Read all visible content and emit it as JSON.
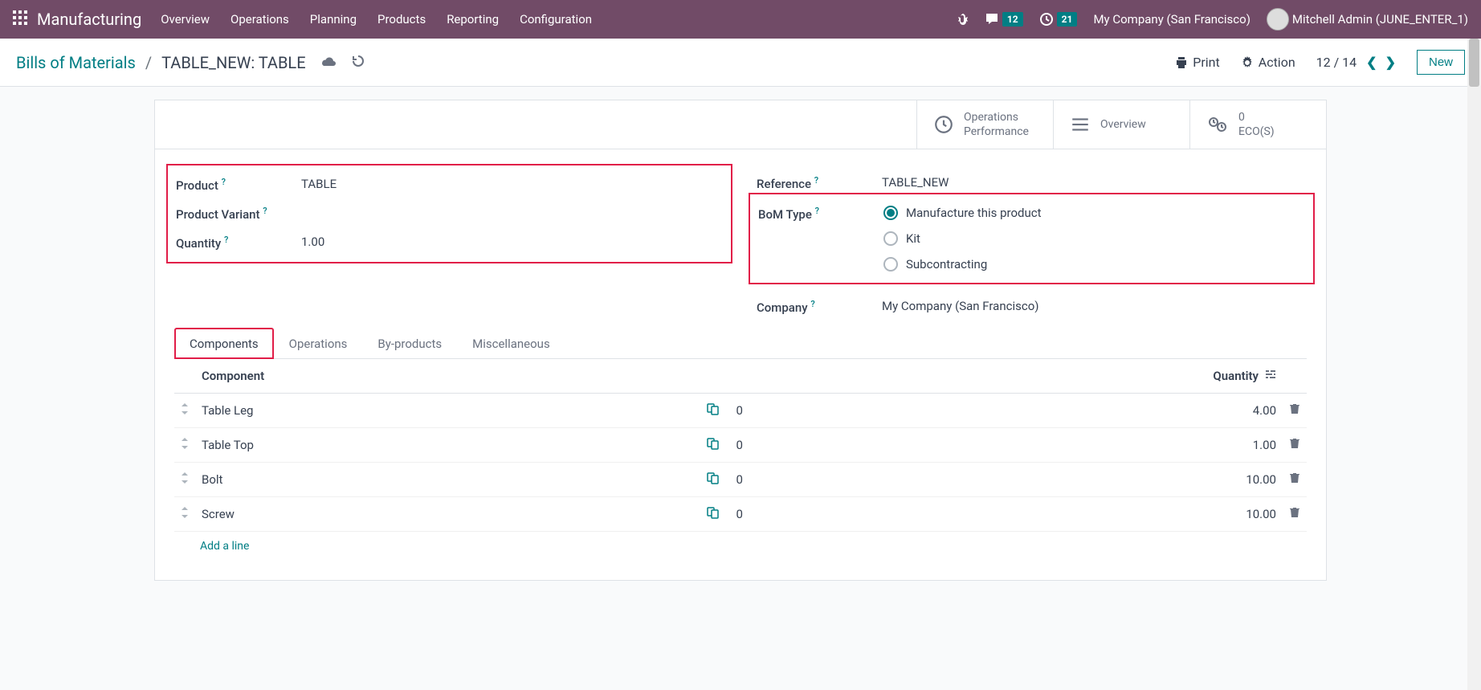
{
  "nav": {
    "brand": "Manufacturing",
    "items": [
      "Overview",
      "Operations",
      "Planning",
      "Products",
      "Reporting",
      "Configuration"
    ],
    "chat_count": "12",
    "activity_count": "21",
    "company": "My Company (San Francisco)",
    "user": "Mitchell Admin (JUNE_ENTER_1)"
  },
  "breadcrumb": {
    "root": "Bills of Materials",
    "current": "TABLE_NEW: TABLE"
  },
  "control": {
    "print": "Print",
    "action": "Action",
    "pager": "12 / 14",
    "new": "New"
  },
  "stat": {
    "ops1": "Operations",
    "ops2": "Performance",
    "overview": "Overview",
    "eco_count": "0",
    "eco_label": "ECO(S)"
  },
  "form": {
    "left": {
      "product_label": "Product",
      "product_value": "TABLE",
      "variant_label": "Product Variant",
      "variant_value": "",
      "qty_label": "Quantity",
      "qty_value": "1.00"
    },
    "right": {
      "reference_label": "Reference",
      "reference_value": "TABLE_NEW",
      "type_label": "BoM Type",
      "type_opts": {
        "manufacture": "Manufacture this product",
        "kit": "Kit",
        "sub": "Subcontracting"
      },
      "company_label": "Company",
      "company_value": "My Company (San Francisco)"
    }
  },
  "tabs": [
    "Components",
    "Operations",
    "By-products",
    "Miscellaneous"
  ],
  "table": {
    "h_component": "Component",
    "h_quantity": "Quantity",
    "rows": [
      {
        "name": "Table Leg",
        "mid": "0",
        "qty": "4.00"
      },
      {
        "name": "Table Top",
        "mid": "0",
        "qty": "1.00"
      },
      {
        "name": "Bolt",
        "mid": "0",
        "qty": "10.00"
      },
      {
        "name": "Screw",
        "mid": "0",
        "qty": "10.00"
      }
    ],
    "add": "Add a line"
  }
}
